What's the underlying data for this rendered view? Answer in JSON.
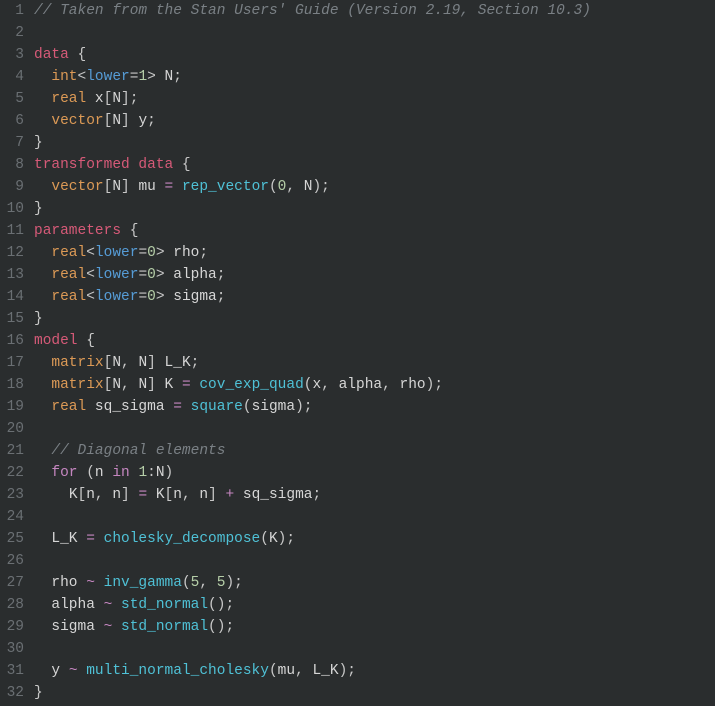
{
  "lines": [
    {
      "n": 1,
      "tokens": [
        [
          "comment",
          "// Taken from the Stan Users' Guide (Version 2.19, Section 10.3)"
        ]
      ]
    },
    {
      "n": 2,
      "tokens": []
    },
    {
      "n": 3,
      "tokens": [
        [
          "kw-block",
          "data"
        ],
        [
          "punct",
          " {"
        ]
      ]
    },
    {
      "n": 4,
      "tokens": [
        [
          "punct",
          "  "
        ],
        [
          "kw-type",
          "int"
        ],
        [
          "punct",
          "<"
        ],
        [
          "kw-attr",
          "lower"
        ],
        [
          "punct",
          "="
        ],
        [
          "num",
          "1"
        ],
        [
          "punct",
          "> "
        ],
        [
          "ident",
          "N"
        ],
        [
          "punct",
          ";"
        ]
      ]
    },
    {
      "n": 5,
      "tokens": [
        [
          "punct",
          "  "
        ],
        [
          "kw-type",
          "real"
        ],
        [
          "punct",
          " "
        ],
        [
          "ident",
          "x"
        ],
        [
          "punct",
          "["
        ],
        [
          "ident",
          "N"
        ],
        [
          "punct",
          "];"
        ]
      ]
    },
    {
      "n": 6,
      "tokens": [
        [
          "punct",
          "  "
        ],
        [
          "kw-type",
          "vector"
        ],
        [
          "punct",
          "["
        ],
        [
          "ident",
          "N"
        ],
        [
          "punct",
          "] "
        ],
        [
          "ident",
          "y"
        ],
        [
          "punct",
          ";"
        ]
      ]
    },
    {
      "n": 7,
      "tokens": [
        [
          "punct",
          "}"
        ]
      ]
    },
    {
      "n": 8,
      "tokens": [
        [
          "kw-block",
          "transformed"
        ],
        [
          "punct",
          " "
        ],
        [
          "kw-block",
          "data"
        ],
        [
          "punct",
          " {"
        ]
      ]
    },
    {
      "n": 9,
      "tokens": [
        [
          "punct",
          "  "
        ],
        [
          "kw-type",
          "vector"
        ],
        [
          "punct",
          "["
        ],
        [
          "ident",
          "N"
        ],
        [
          "punct",
          "] "
        ],
        [
          "ident",
          "mu"
        ],
        [
          "punct",
          " "
        ],
        [
          "eq",
          "="
        ],
        [
          "punct",
          " "
        ],
        [
          "func",
          "rep_vector"
        ],
        [
          "punct",
          "("
        ],
        [
          "num",
          "0"
        ],
        [
          "punct",
          ", "
        ],
        [
          "ident",
          "N"
        ],
        [
          "punct",
          ");"
        ]
      ]
    },
    {
      "n": 10,
      "tokens": [
        [
          "punct",
          "}"
        ]
      ]
    },
    {
      "n": 11,
      "tokens": [
        [
          "kw-block",
          "parameters"
        ],
        [
          "punct",
          " {"
        ]
      ]
    },
    {
      "n": 12,
      "tokens": [
        [
          "punct",
          "  "
        ],
        [
          "kw-type",
          "real"
        ],
        [
          "punct",
          "<"
        ],
        [
          "kw-attr",
          "lower"
        ],
        [
          "punct",
          "="
        ],
        [
          "num",
          "0"
        ],
        [
          "punct",
          "> "
        ],
        [
          "ident",
          "rho"
        ],
        [
          "punct",
          ";"
        ]
      ]
    },
    {
      "n": 13,
      "tokens": [
        [
          "punct",
          "  "
        ],
        [
          "kw-type",
          "real"
        ],
        [
          "punct",
          "<"
        ],
        [
          "kw-attr",
          "lower"
        ],
        [
          "punct",
          "="
        ],
        [
          "num",
          "0"
        ],
        [
          "punct",
          "> "
        ],
        [
          "ident",
          "alpha"
        ],
        [
          "punct",
          ";"
        ]
      ]
    },
    {
      "n": 14,
      "tokens": [
        [
          "punct",
          "  "
        ],
        [
          "kw-type",
          "real"
        ],
        [
          "punct",
          "<"
        ],
        [
          "kw-attr",
          "lower"
        ],
        [
          "punct",
          "="
        ],
        [
          "num",
          "0"
        ],
        [
          "punct",
          "> "
        ],
        [
          "ident",
          "sigma"
        ],
        [
          "punct",
          ";"
        ]
      ]
    },
    {
      "n": 15,
      "tokens": [
        [
          "punct",
          "}"
        ]
      ]
    },
    {
      "n": 16,
      "tokens": [
        [
          "kw-block",
          "model"
        ],
        [
          "punct",
          " {"
        ]
      ]
    },
    {
      "n": 17,
      "tokens": [
        [
          "punct",
          "  "
        ],
        [
          "kw-type",
          "matrix"
        ],
        [
          "punct",
          "["
        ],
        [
          "ident",
          "N"
        ],
        [
          "punct",
          ", "
        ],
        [
          "ident",
          "N"
        ],
        [
          "punct",
          "] "
        ],
        [
          "ident",
          "L_K"
        ],
        [
          "punct",
          ";"
        ]
      ]
    },
    {
      "n": 18,
      "tokens": [
        [
          "punct",
          "  "
        ],
        [
          "kw-type",
          "matrix"
        ],
        [
          "punct",
          "["
        ],
        [
          "ident",
          "N"
        ],
        [
          "punct",
          ", "
        ],
        [
          "ident",
          "N"
        ],
        [
          "punct",
          "] "
        ],
        [
          "ident",
          "K"
        ],
        [
          "punct",
          " "
        ],
        [
          "eq",
          "="
        ],
        [
          "punct",
          " "
        ],
        [
          "func",
          "cov_exp_quad"
        ],
        [
          "punct",
          "("
        ],
        [
          "ident",
          "x"
        ],
        [
          "punct",
          ", "
        ],
        [
          "ident",
          "alpha"
        ],
        [
          "punct",
          ", "
        ],
        [
          "ident",
          "rho"
        ],
        [
          "punct",
          ");"
        ]
      ]
    },
    {
      "n": 19,
      "tokens": [
        [
          "punct",
          "  "
        ],
        [
          "kw-type",
          "real"
        ],
        [
          "punct",
          " "
        ],
        [
          "ident",
          "sq_sigma"
        ],
        [
          "punct",
          " "
        ],
        [
          "eq",
          "="
        ],
        [
          "punct",
          " "
        ],
        [
          "func",
          "square"
        ],
        [
          "punct",
          "("
        ],
        [
          "ident",
          "sigma"
        ],
        [
          "punct",
          ");"
        ]
      ]
    },
    {
      "n": 20,
      "tokens": []
    },
    {
      "n": 21,
      "tokens": [
        [
          "punct",
          "  "
        ],
        [
          "comment",
          "// Diagonal elements"
        ]
      ]
    },
    {
      "n": 22,
      "tokens": [
        [
          "punct",
          "  "
        ],
        [
          "kw-ctrl",
          "for"
        ],
        [
          "punct",
          " ("
        ],
        [
          "ident",
          "n"
        ],
        [
          "punct",
          " "
        ],
        [
          "kw-ctrl",
          "in"
        ],
        [
          "punct",
          " "
        ],
        [
          "num",
          "1"
        ],
        [
          "punct",
          ":"
        ],
        [
          "ident",
          "N"
        ],
        [
          "punct",
          ")"
        ]
      ]
    },
    {
      "n": 23,
      "tokens": [
        [
          "punct",
          "    "
        ],
        [
          "ident",
          "K"
        ],
        [
          "punct",
          "["
        ],
        [
          "ident",
          "n"
        ],
        [
          "punct",
          ", "
        ],
        [
          "ident",
          "n"
        ],
        [
          "punct",
          "] "
        ],
        [
          "eq",
          "="
        ],
        [
          "punct",
          " "
        ],
        [
          "ident",
          "K"
        ],
        [
          "punct",
          "["
        ],
        [
          "ident",
          "n"
        ],
        [
          "punct",
          ", "
        ],
        [
          "ident",
          "n"
        ],
        [
          "punct",
          "] "
        ],
        [
          "eq",
          "+"
        ],
        [
          "punct",
          " "
        ],
        [
          "ident",
          "sq_sigma"
        ],
        [
          "punct",
          ";"
        ]
      ]
    },
    {
      "n": 24,
      "tokens": []
    },
    {
      "n": 25,
      "tokens": [
        [
          "punct",
          "  "
        ],
        [
          "ident",
          "L_K"
        ],
        [
          "punct",
          " "
        ],
        [
          "eq",
          "="
        ],
        [
          "punct",
          " "
        ],
        [
          "func",
          "cholesky_decompose"
        ],
        [
          "punct",
          "("
        ],
        [
          "ident",
          "K"
        ],
        [
          "punct",
          ");"
        ]
      ]
    },
    {
      "n": 26,
      "tokens": []
    },
    {
      "n": 27,
      "tokens": [
        [
          "punct",
          "  "
        ],
        [
          "ident",
          "rho"
        ],
        [
          "punct",
          " "
        ],
        [
          "kw-op",
          "~"
        ],
        [
          "punct",
          " "
        ],
        [
          "func",
          "inv_gamma"
        ],
        [
          "punct",
          "("
        ],
        [
          "num",
          "5"
        ],
        [
          "punct",
          ", "
        ],
        [
          "num",
          "5"
        ],
        [
          "punct",
          ");"
        ]
      ]
    },
    {
      "n": 28,
      "tokens": [
        [
          "punct",
          "  "
        ],
        [
          "ident",
          "alpha"
        ],
        [
          "punct",
          " "
        ],
        [
          "kw-op",
          "~"
        ],
        [
          "punct",
          " "
        ],
        [
          "func",
          "std_normal"
        ],
        [
          "punct",
          "();"
        ]
      ]
    },
    {
      "n": 29,
      "tokens": [
        [
          "punct",
          "  "
        ],
        [
          "ident",
          "sigma"
        ],
        [
          "punct",
          " "
        ],
        [
          "kw-op",
          "~"
        ],
        [
          "punct",
          " "
        ],
        [
          "func",
          "std_normal"
        ],
        [
          "punct",
          "();"
        ]
      ]
    },
    {
      "n": 30,
      "tokens": []
    },
    {
      "n": 31,
      "tokens": [
        [
          "punct",
          "  "
        ],
        [
          "ident",
          "y"
        ],
        [
          "punct",
          " "
        ],
        [
          "kw-op",
          "~"
        ],
        [
          "punct",
          " "
        ],
        [
          "func",
          "multi_normal_cholesky"
        ],
        [
          "punct",
          "("
        ],
        [
          "ident",
          "mu"
        ],
        [
          "punct",
          ", "
        ],
        [
          "ident",
          "L_K"
        ],
        [
          "punct",
          ");"
        ]
      ]
    },
    {
      "n": 32,
      "tokens": [
        [
          "punct",
          "}"
        ]
      ]
    }
  ]
}
